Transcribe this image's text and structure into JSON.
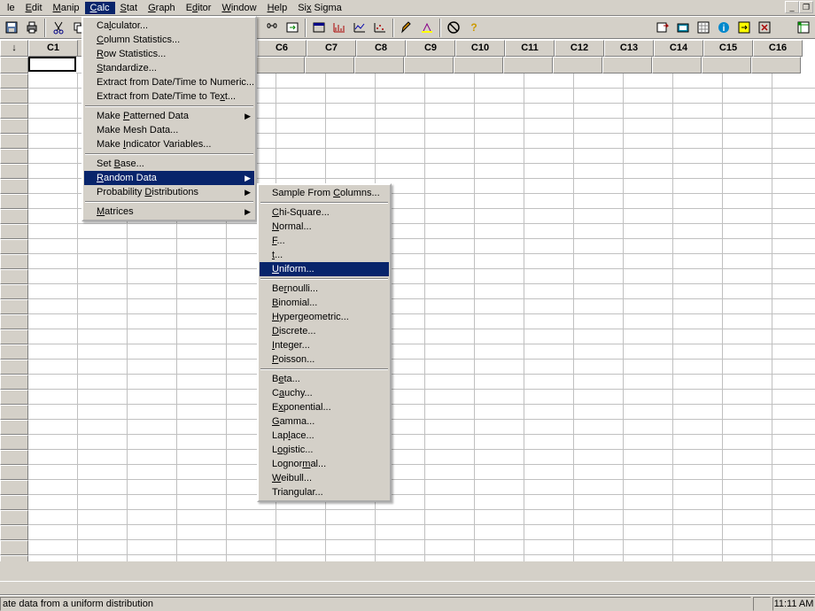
{
  "menubar": {
    "items": [
      {
        "label": "le",
        "hotkey_pos": 0
      },
      {
        "label": "Edit"
      },
      {
        "label": "Manip"
      },
      {
        "label": "Calc"
      },
      {
        "label": "Stat"
      },
      {
        "label": "Graph"
      },
      {
        "label": "Editor"
      },
      {
        "label": "Window"
      },
      {
        "label": "Help"
      },
      {
        "label": "Six Sigma"
      }
    ]
  },
  "namebox": {
    "value": "C1"
  },
  "column_headers": [
    "C6",
    "C7",
    "C8",
    "C9",
    "C10",
    "C11",
    "C12",
    "C13",
    "C14",
    "C15",
    "C16"
  ],
  "calc_menu": {
    "group1": [
      "Calculator...",
      "Column Statistics...",
      "Row Statistics...",
      "Standardize...",
      "Extract from Date/Time to Numeric...",
      "Extract from Date/Time to Text..."
    ],
    "group2": [
      {
        "label": "Make Patterned Data",
        "submenu": true
      },
      {
        "label": "Make Mesh Data..."
      },
      {
        "label": "Make Indicator Variables..."
      }
    ],
    "group3": [
      {
        "label": "Set Base..."
      },
      {
        "label": "Random Data",
        "submenu": true,
        "highlight": true
      },
      {
        "label": "Probability Distributions",
        "submenu": true
      }
    ],
    "group4": [
      {
        "label": "Matrices",
        "submenu": true
      }
    ]
  },
  "random_submenu": {
    "group1": [
      "Sample From Columns..."
    ],
    "group2": [
      "Chi-Square...",
      "Normal...",
      "F...",
      "t...",
      {
        "label": "Uniform...",
        "highlight": true
      }
    ],
    "group3": [
      "Bernoulli...",
      "Binomial...",
      "Hypergeometric...",
      "Discrete...",
      "Integer...",
      "Poisson..."
    ],
    "group4": [
      "Beta...",
      "Cauchy...",
      "Exponential...",
      "Gamma...",
      "Laplace...",
      "Logistic...",
      "Lognormal...",
      "Weibull...",
      "Triangular..."
    ]
  },
  "status": {
    "text": "ate data from a uniform distribution",
    "time": "11:11 AM"
  },
  "toolbar_icons": [
    "save-icon",
    "print-icon",
    "",
    "cut-icon",
    "copy-icon",
    "paste-icon",
    "",
    "undo-icon",
    "redo-icon"
  ],
  "toolbar_right_icons": [
    "find-icon",
    "goto-icon",
    "",
    "chart1-icon",
    "chart2-icon",
    "chart3-icon",
    "chart4-icon",
    "",
    "brush-icon",
    "highlight-icon",
    "",
    "cancel-icon",
    "help-icon"
  ],
  "toolbar_far_icons": [
    "window-icon",
    "cascade-icon",
    "tile-icon",
    "info-icon",
    "run-icon",
    "stop-icon",
    "spacer",
    "worksheet-icon"
  ]
}
